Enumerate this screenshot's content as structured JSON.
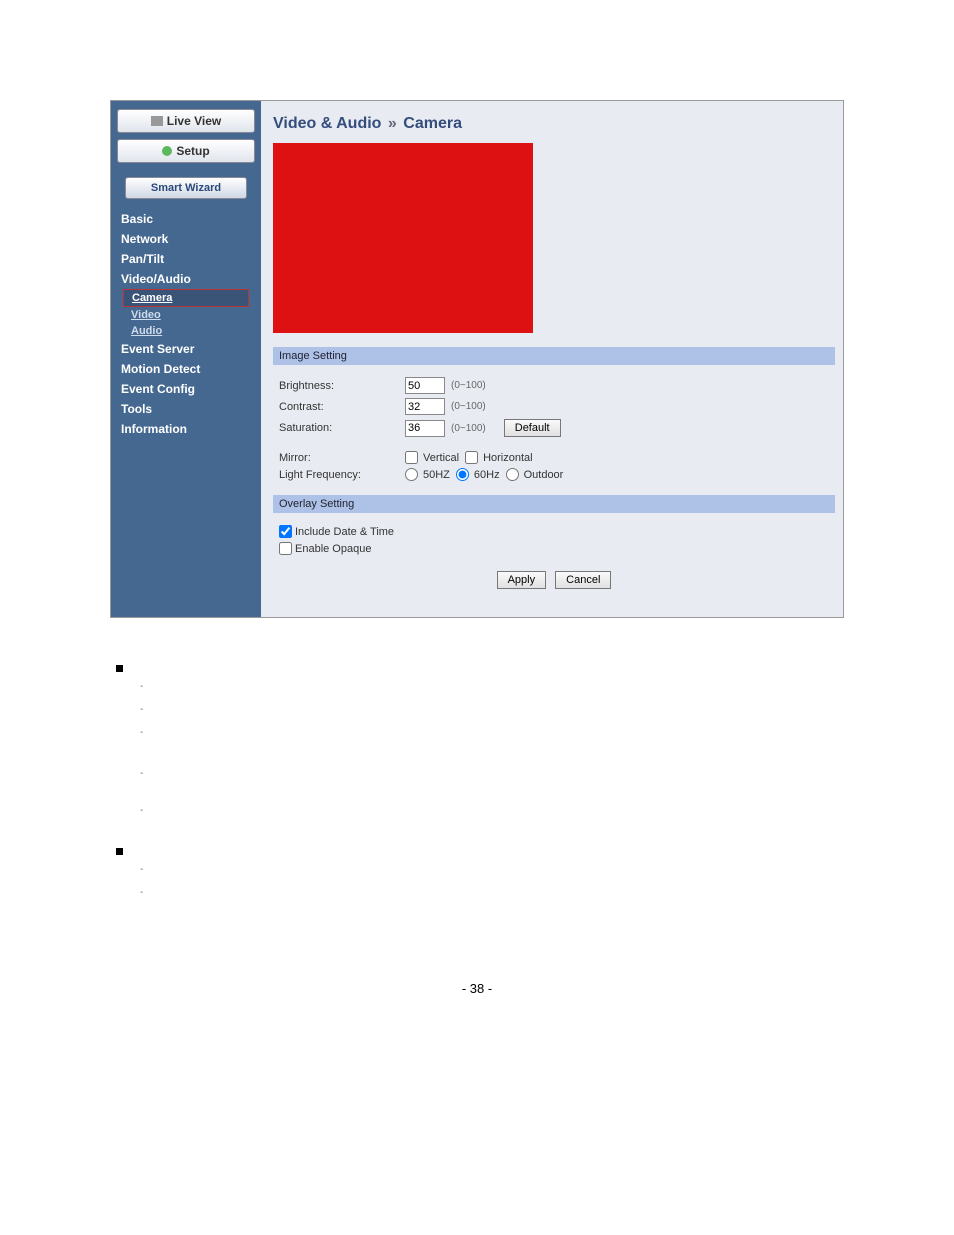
{
  "sidebar": {
    "liveView": "Live View",
    "setup": "Setup",
    "smartWizard": "Smart Wizard",
    "menu": {
      "basic": "Basic",
      "network": "Network",
      "panTilt": "Pan/Tilt",
      "videoAudio": "Video/Audio",
      "videoAudioSub": {
        "camera": "Camera",
        "video": "Video",
        "audio": "Audio"
      },
      "eventServer": "Event Server",
      "motionDetect": "Motion Detect",
      "eventConfig": "Event Config",
      "tools": "Tools",
      "information": "Information"
    }
  },
  "content": {
    "title1": "Video & Audio",
    "sep": "»",
    "title2": "Camera",
    "imageSetting": {
      "header": "Image Setting",
      "brightnessLabel": "Brightness:",
      "brightnessVal": "50",
      "contrastLabel": "Contrast:",
      "contrastVal": "32",
      "saturationLabel": "Saturation:",
      "saturationVal": "36",
      "range": "(0~100)",
      "defaultBtn": "Default",
      "mirrorLabel": "Mirror:",
      "mirrorVertical": "Vertical",
      "mirrorHorizontal": "Horizontal",
      "lightFreqLabel": "Light Frequency:",
      "freq50": "50HZ",
      "freq60": "60Hz",
      "freqOutdoor": "Outdoor"
    },
    "overlaySetting": {
      "header": "Overlay Setting",
      "includeDateTime": "Include Date & Time",
      "enableOpaque": "Enable Opaque"
    },
    "actions": {
      "apply": "Apply",
      "cancel": "Cancel"
    }
  },
  "pageNumber": "- 38 -"
}
